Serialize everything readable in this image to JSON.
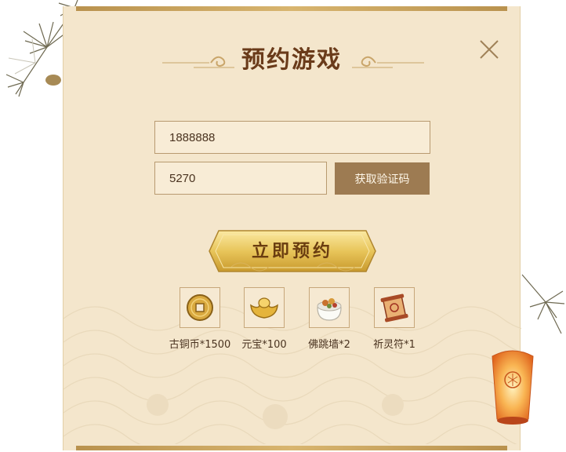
{
  "dialog": {
    "title": "预约游戏"
  },
  "form": {
    "phone_value": "1888888",
    "code_value": "5270",
    "get_code_label": "获取验证码",
    "submit_label": "立即预约"
  },
  "rewards": [
    {
      "icon": "copper-coin-icon",
      "label": "古铜币*1500"
    },
    {
      "icon": "gold-ingot-icon",
      "label": "元宝*100"
    },
    {
      "icon": "buddha-jumps-wall-dish-icon",
      "label": "佛跳墙*2"
    },
    {
      "icon": "scroll-talisman-icon",
      "label": "祈灵符*1"
    }
  ],
  "colors": {
    "panel_bg": "#f4e6cc",
    "title_text": "#6a3b1a",
    "gold_button": "#e6c45e",
    "code_button": "#9d7b52",
    "border": "#b89a70"
  }
}
